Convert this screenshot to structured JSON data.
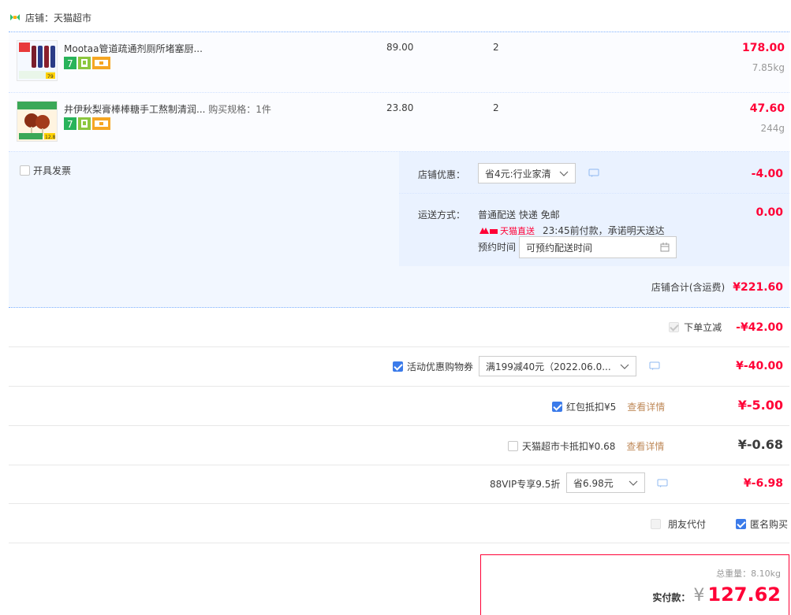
{
  "shop": {
    "label": "店铺：天猫超市"
  },
  "items": [
    {
      "title": "Mootaa管道疏通剂厕所堵塞厨...",
      "spec": "",
      "price": "89.00",
      "qty": "2",
      "subtotal": "178.00",
      "weight": "7.85kg",
      "thumb_price": "79"
    },
    {
      "title": "井伊秋梨膏棒棒糖手工熬制清润...",
      "spec": "购买规格：1件",
      "price": "23.80",
      "qty": "2",
      "subtotal": "47.60",
      "weight": "244g",
      "thumb_price": "12.8"
    }
  ],
  "invoice": {
    "label": "开具发票"
  },
  "shop_discount": {
    "label": "店铺优惠：",
    "selected": "省4元:行业家清",
    "amount": "-4.00"
  },
  "shipping": {
    "label": "运送方式：",
    "method": "普通配送 快递 免邮",
    "amount": "0.00",
    "direct_badge": "天猫直送",
    "promise": "23:45前付款，承诺明天送达",
    "appointment_label": "预约时间",
    "appointment_placeholder": "可预约配送时间"
  },
  "shop_total": {
    "label": "店铺合计(含运费)",
    "amount": "¥221.60"
  },
  "discounts": {
    "instant": {
      "label": "下单立减",
      "amount": "-¥42.00"
    },
    "coupon": {
      "label": "活动优惠购物券",
      "selected": "满199减40元（2022.06.0...",
      "amount": "¥-40.00"
    },
    "red_packet": {
      "label": "红包抵扣¥5",
      "link": "查看详情",
      "amount": "¥-5.00"
    },
    "tmall_card": {
      "label": "天猫超市卡抵扣¥0.68",
      "link": "查看详情",
      "amount": "¥-0.68"
    },
    "vip": {
      "label": "88VIP专享9.5折",
      "selected": "省6.98元",
      "amount": "¥-6.98"
    }
  },
  "options": {
    "friend_pay": "朋友代付",
    "anonymous": "匿名购买"
  },
  "summary": {
    "weight_label": "总重量：",
    "weight": "8.10kg",
    "paid_label": "实付款：",
    "currency": "¥",
    "total": "127.62"
  },
  "colors": {
    "accent": "#ff0036",
    "blue": "#3b7bea",
    "link": "#bf8a5a"
  }
}
